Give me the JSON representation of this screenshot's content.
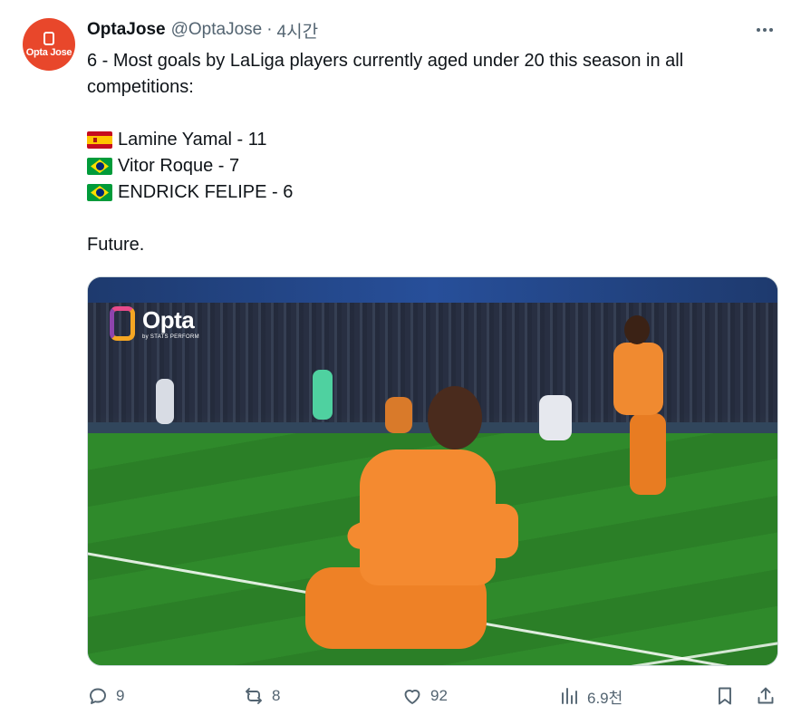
{
  "author": {
    "avatar_text": "Opta Jose",
    "name": "OptaJose",
    "handle": "@OptaJose",
    "separator": "·",
    "time": "4시간"
  },
  "tweet": {
    "lines": [
      "6 - Most goals by LaLiga players currently aged under 20 this season in all competitions:",
      "",
      "Lamine Yamal - 11",
      "Vitor Roque - 7",
      "ENDRICK FELIPE - 6",
      "",
      "Future."
    ],
    "flags": [
      "flag-spain",
      "flag-brazil",
      "flag-brazil"
    ]
  },
  "media": {
    "logo_word": "Opta",
    "logo_sub": "by STATS PERFORM"
  },
  "actions": {
    "reply_count": "9",
    "repost_count": "8",
    "like_count": "92",
    "views_count": "6.9천"
  },
  "icons": {
    "more": "more-icon",
    "reply": "reply-icon",
    "repost": "repost-icon",
    "like": "heart-icon",
    "views": "views-icon",
    "bookmark": "bookmark-icon",
    "share": "share-icon"
  },
  "colors": {
    "avatar_bg": "#e8472b",
    "secondary_text": "#536471",
    "primary_text": "#0f1419",
    "jersey_orange": "#f48a30"
  }
}
